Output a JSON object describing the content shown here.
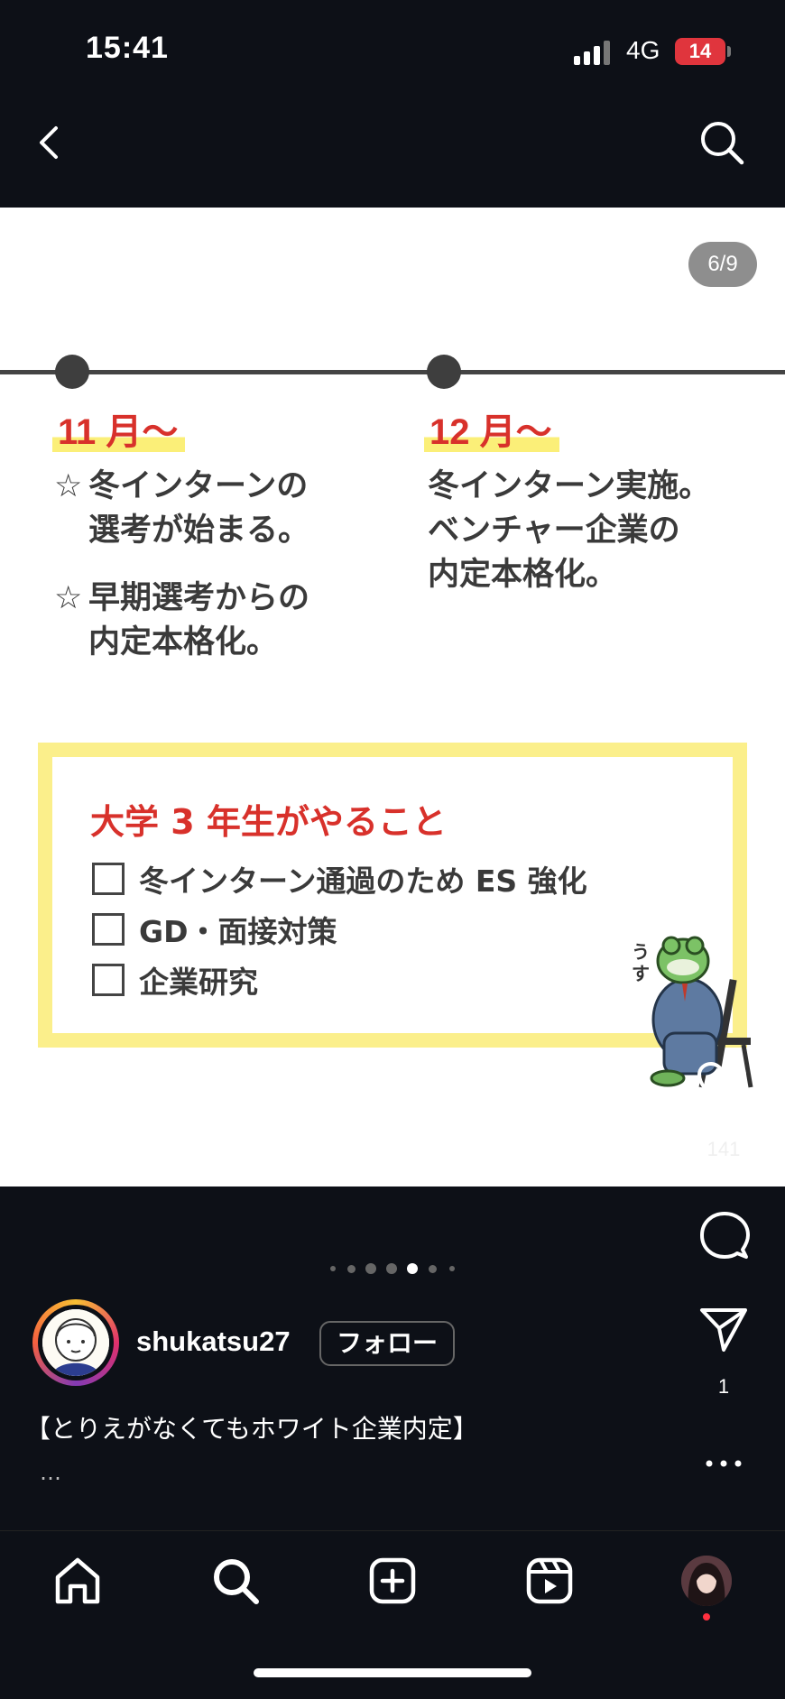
{
  "status_bar": {
    "time": "15:41",
    "network": "4G",
    "battery": "14"
  },
  "post": {
    "counter": "6/9",
    "timeline": [
      {
        "month": "11 月〜",
        "items": [
          "冬インターンの選考が始まる。",
          "早期選考からの内定本格化。"
        ],
        "item_lines": [
          [
            "冬インターンの",
            "選考が始まる。"
          ],
          [
            "早期選考からの",
            "内定本格化。"
          ]
        ],
        "bullet": "☆"
      },
      {
        "month": "12 月〜",
        "lines": [
          "冬インターン実施。",
          "ベンチャー企業の",
          "内定本格化。"
        ]
      }
    ],
    "todo": {
      "title": "大学 3 年生がやること",
      "items": [
        "冬インターン通過のため ES 強化",
        "GD・面接対策",
        "企業研究"
      ]
    },
    "sticker_text": "うす",
    "like_count": "141"
  },
  "actions": {
    "share_count": "1"
  },
  "carousel": {
    "total": 7,
    "active": 4
  },
  "profile": {
    "username": "shukatsu27",
    "follow_label": "フォロー"
  },
  "caption": {
    "text": "【とりえがなくてもホワイト企業内定】",
    "more": "…"
  },
  "icons": {
    "back": "chevron-left-icon",
    "search": "search-icon",
    "like": "heart-icon",
    "comment": "comment-icon",
    "share": "paper-plane-icon",
    "more": "more-icon",
    "nav": [
      "home-icon",
      "search-icon",
      "create-icon",
      "reels-icon",
      "profile-avatar"
    ]
  },
  "colors": {
    "accent_red": "#d8312b",
    "highlight_yellow": "#fbef78",
    "background": "#0d1017"
  }
}
